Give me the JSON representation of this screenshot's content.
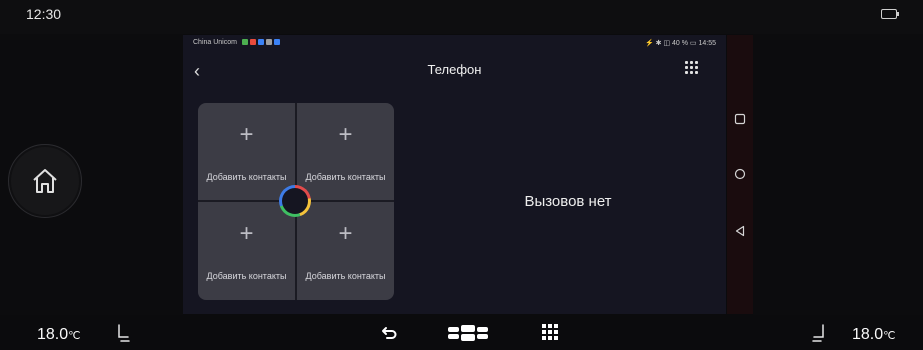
{
  "top_status": {
    "time": "12:30"
  },
  "phone_status": {
    "carrier": "China Unicom",
    "right": "⚡ ✱ ◫ 40 % ▭ 14:55"
  },
  "app": {
    "title": "Телефон"
  },
  "contacts": [
    {
      "label": "Добавить контакты"
    },
    {
      "label": "Добавить контакты"
    },
    {
      "label": "Добавить контакты"
    },
    {
      "label": "Добавить контакты"
    }
  ],
  "call_log": {
    "empty_text": "Вызовов нет"
  },
  "climate": {
    "left_temp": "18.0",
    "right_temp": "18.0",
    "unit": "℃"
  },
  "colors": {
    "accent_ring": [
      "#e24b4b",
      "#f5c33b",
      "#3fbf63",
      "#3d7be6"
    ]
  }
}
